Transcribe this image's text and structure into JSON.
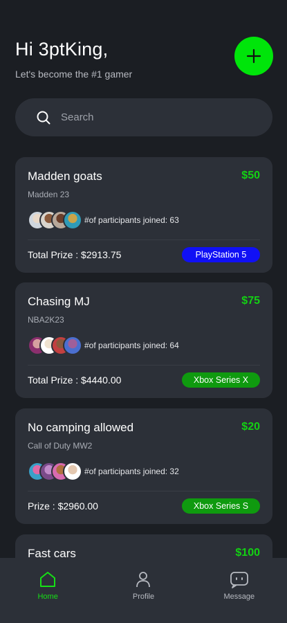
{
  "header": {
    "greeting": "Hi 3ptKing,",
    "subtitle": "Let's become the #1 gamer"
  },
  "search": {
    "placeholder": "Search"
  },
  "colors": {
    "accent": "#00e50a",
    "price_green": "#13d113",
    "card_bg": "#2c3038",
    "page_bg": "#1b1e23",
    "playstation_blue": "#1010f5",
    "xbox_green": "#0f9a0f"
  },
  "tournaments": [
    {
      "title": "Madden goats",
      "game": "Madden 23",
      "price": "$50",
      "participants": "#of participants joined: 63",
      "prize": "Total Prize : $2913.75",
      "platform": "PlayStation 5"
    },
    {
      "title": "Chasing MJ",
      "game": "NBA2K23",
      "price": "$75",
      "participants": "#of participants joined: 64",
      "prize": "Total Prize : $4440.00",
      "platform": "Xbox Series X"
    },
    {
      "title": "No camping allowed",
      "game": "Call of Duty MW2",
      "price": "$20",
      "participants": "#of participants joined: 32",
      "prize": "Prize : $2960.00",
      "platform": "Xbox Series S"
    },
    {
      "title": "Fast cars",
      "price": "$100"
    }
  ],
  "tabbar": {
    "home": "Home",
    "profile": "Profile",
    "message": "Message"
  }
}
